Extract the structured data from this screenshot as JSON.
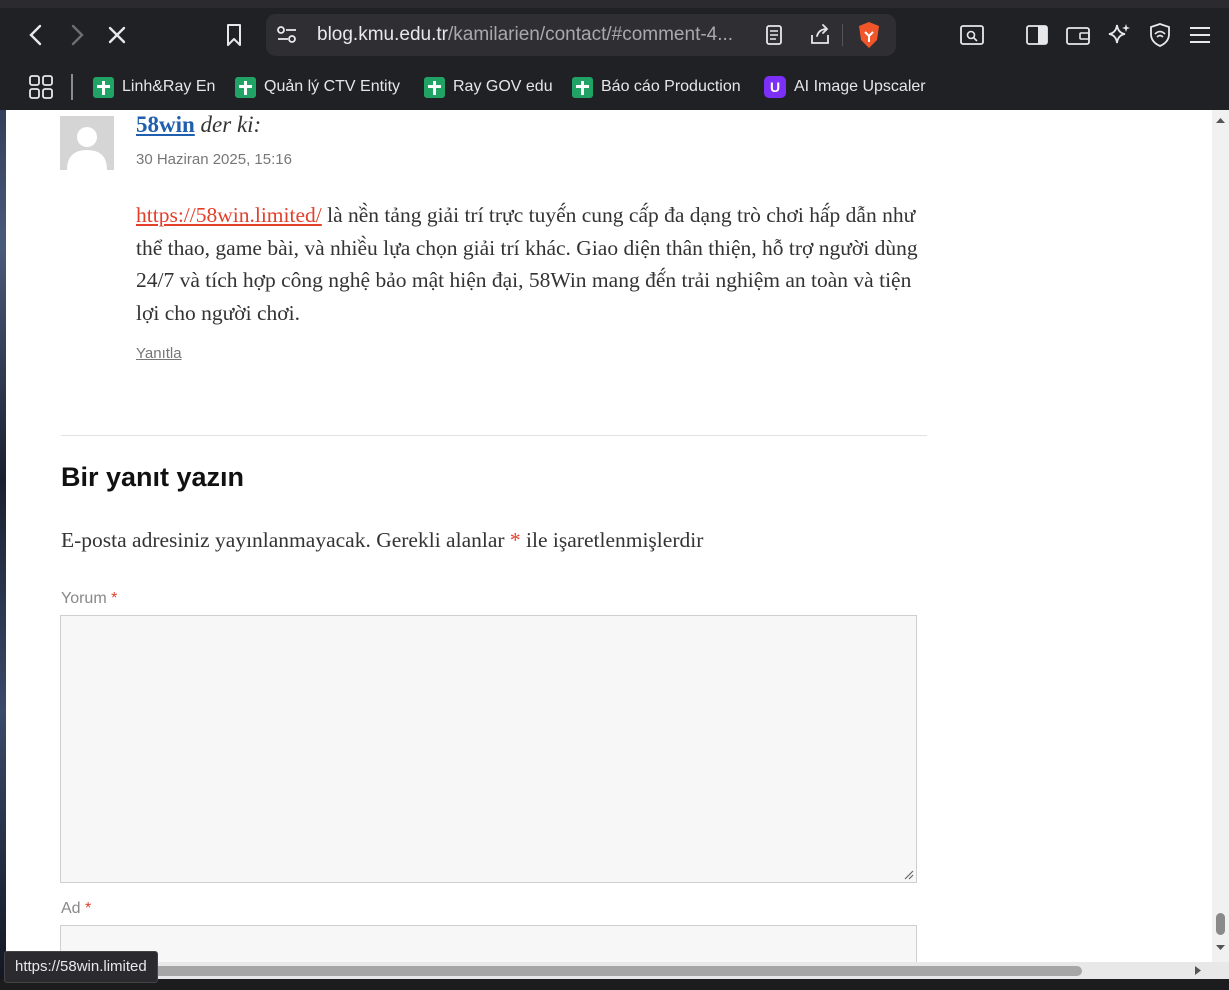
{
  "browser": {
    "url_host": "blog.kmu.edu.tr",
    "url_path": "/kamilarien/contact/#comment-4..."
  },
  "bookmarks": [
    {
      "label": "Linh&Ray En",
      "icon": "spreadsheet-icon"
    },
    {
      "label": "Quản lý CTV Entity",
      "icon": "spreadsheet-icon"
    },
    {
      "label": "Ray GOV edu",
      "icon": "spreadsheet-icon"
    },
    {
      "label": "Báo cáo Production",
      "icon": "spreadsheet-icon"
    },
    {
      "label": "AI Image Upscaler",
      "icon": "ai-upscaler-icon"
    }
  ],
  "comment": {
    "author": "58win",
    "says": "der ki:",
    "date": "30 Haziran 2025, 15:16",
    "link_text": "https://58win.limited/",
    "body_text": " là nề̀n tảng giải trí trực tuyế́n cung cấ́p đa dạng trò chơi hấ́p dẫn như thể thao, game bài, và nhiề̀u lựa chọn giải trí khác. Giao diện thân thiện, hỗ trợ người dùng 24/7 và tích hợp công nghệ bảo mật hiện đại, 58Win mang đế́n trải nghiệm an toàn và tiện lợi cho người chơi.",
    "reply_label": "Yanıtla"
  },
  "form": {
    "title": "Bir yanıt yazın",
    "note_before": "E-posta adresiniz yayınlanmayacak. Gerekli alanlar ",
    "required_mark": "*",
    "note_after": " ile işaretlenmişlerdir",
    "comment_label": "Yorum",
    "name_label": "Ad"
  },
  "status_bar": {
    "text": "https://58win.limited"
  },
  "colors": {
    "link": "#1f5fad",
    "accent_red": "#e2402b",
    "bookmark_green": "#21a366"
  }
}
